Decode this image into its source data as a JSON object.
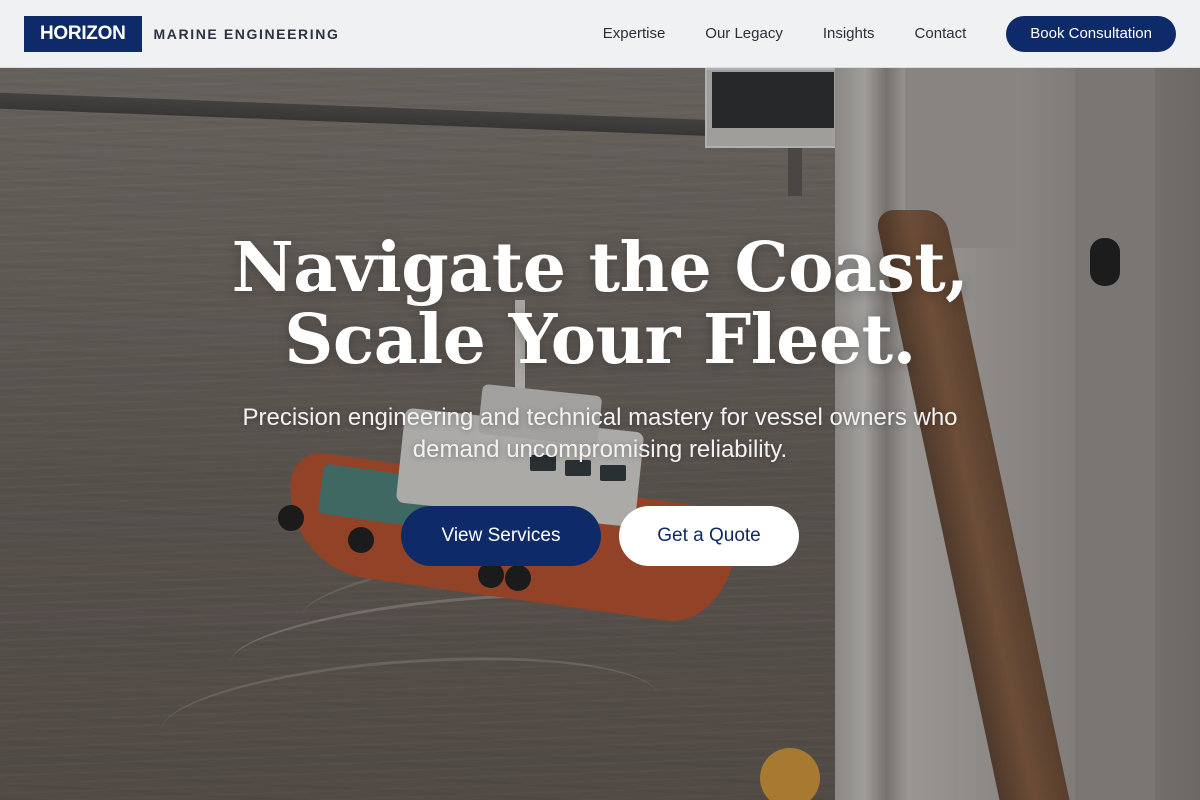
{
  "brand": {
    "logo_text": "HORIZON",
    "tagline": "MARINE ENGINEERING"
  },
  "nav": {
    "links": [
      {
        "label": "Expertise"
      },
      {
        "label": "Our Legacy"
      },
      {
        "label": "Insights"
      },
      {
        "label": "Contact"
      }
    ],
    "cta_label": "Book Consultation"
  },
  "hero": {
    "headline_line1": "Navigate the Coast,",
    "headline_line2": "Scale Your Fleet.",
    "subheadline": "Precision engineering and technical mastery for vessel owners who demand uncompromising reliability.",
    "primary_button": "View Services",
    "secondary_button": "Get a Quote"
  },
  "colors": {
    "brand_navy": "#0f2a68",
    "nav_background": "#f6f7f9",
    "white": "#ffffff"
  }
}
